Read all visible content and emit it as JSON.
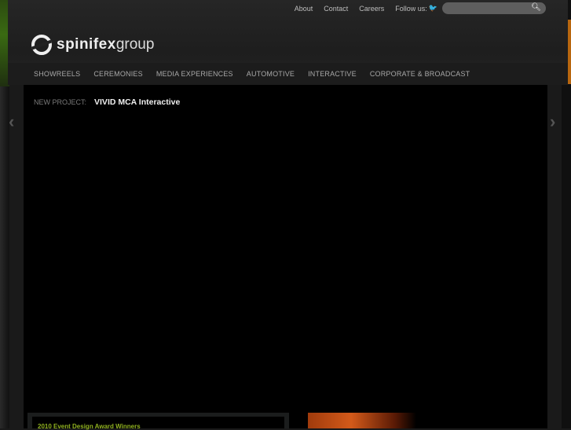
{
  "topbar": {
    "links": [
      "About",
      "Contact",
      "Careers"
    ],
    "follow_label": "Follow us:",
    "search_placeholder": ""
  },
  "logo": {
    "bold": "spinifex",
    "light": "group"
  },
  "nav": [
    "SHOWREELS",
    "CEREMONIES",
    "MEDIA EXPERIENCES",
    "AUTOMOTIVE",
    "INTERACTIVE",
    "CORPORATE & BROADCAST"
  ],
  "feature": {
    "label": "NEW PROJECT:",
    "title": "VIVID MCA Interactive"
  },
  "news": {
    "heading": "2010 Event Design Award Winners"
  },
  "colors": {
    "accent": "#8fb020",
    "orange": "#b8660e"
  }
}
